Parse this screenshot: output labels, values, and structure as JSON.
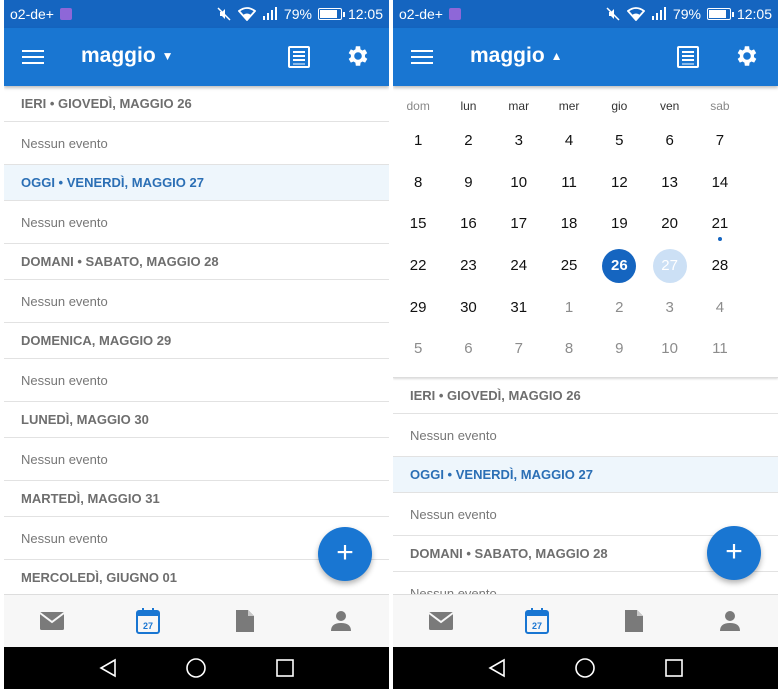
{
  "status_bar": {
    "carrier": "o2-de+",
    "battery": "79%",
    "time": "12:05"
  },
  "left": {
    "app_bar": {
      "title": "maggio",
      "chevron": "▼"
    },
    "agenda": [
      {
        "header": "IERI • GIOVEDÌ, MAGGIO 26",
        "item": "Nessun evento",
        "today": false
      },
      {
        "header": "OGGI • VENERDÌ, MAGGIO 27",
        "item": "Nessun evento",
        "today": true
      },
      {
        "header": "DOMANI • SABATO, MAGGIO 28",
        "item": "Nessun evento",
        "today": false
      },
      {
        "header": "DOMENICA, MAGGIO 29",
        "item": "Nessun evento",
        "today": false
      },
      {
        "header": "LUNEDÌ, MAGGIO 30",
        "item": "Nessun evento",
        "today": false
      },
      {
        "header": "MARTEDÌ, MAGGIO 31",
        "item": "Nessun evento",
        "today": false
      },
      {
        "header": "MERCOLEDÌ, GIUGNO 01",
        "item": "",
        "today": false
      }
    ]
  },
  "right": {
    "app_bar": {
      "title": "maggio",
      "chevron": "▲"
    },
    "calendar": {
      "weekdays": [
        "dom",
        "lun",
        "mar",
        "mer",
        "gio",
        "ven",
        "sab"
      ],
      "weeks": [
        [
          "1",
          "2",
          "3",
          "4",
          "5",
          "6",
          "7"
        ],
        [
          "8",
          "9",
          "10",
          "11",
          "12",
          "13",
          "14"
        ],
        [
          "15",
          "16",
          "17",
          "18",
          "19",
          "20",
          "21"
        ],
        [
          "22",
          "23",
          "24",
          "25",
          "26",
          "27",
          "28"
        ],
        [
          "29",
          "30",
          "31",
          "1",
          "2",
          "3",
          "4"
        ],
        [
          "5",
          "6",
          "7",
          "8",
          "9",
          "10",
          "11"
        ]
      ]
    },
    "agenda": [
      {
        "header": "IERI • GIOVEDÌ, MAGGIO 26",
        "item": "Nessun evento",
        "today": false
      },
      {
        "header": "OGGI • VENERDÌ, MAGGIO 27",
        "item": "Nessun evento",
        "today": true
      },
      {
        "header": "DOMANI • SABATO, MAGGIO 28",
        "item": "Nessun evento",
        "today": false
      }
    ]
  },
  "fab_label": "+",
  "colors": {
    "app_bar": "#1976d2",
    "status_bar": "#1565c0",
    "selected_day": "#1565c0",
    "today_day": "#cce0f5",
    "today_header_bg": "#eef6fc"
  },
  "tabs": [
    "mail-icon",
    "calendar-icon",
    "files-icon",
    "people-icon"
  ],
  "calendar_tab_day": "27",
  "nav_buttons": [
    "back-icon",
    "home-icon",
    "recents-icon"
  ]
}
